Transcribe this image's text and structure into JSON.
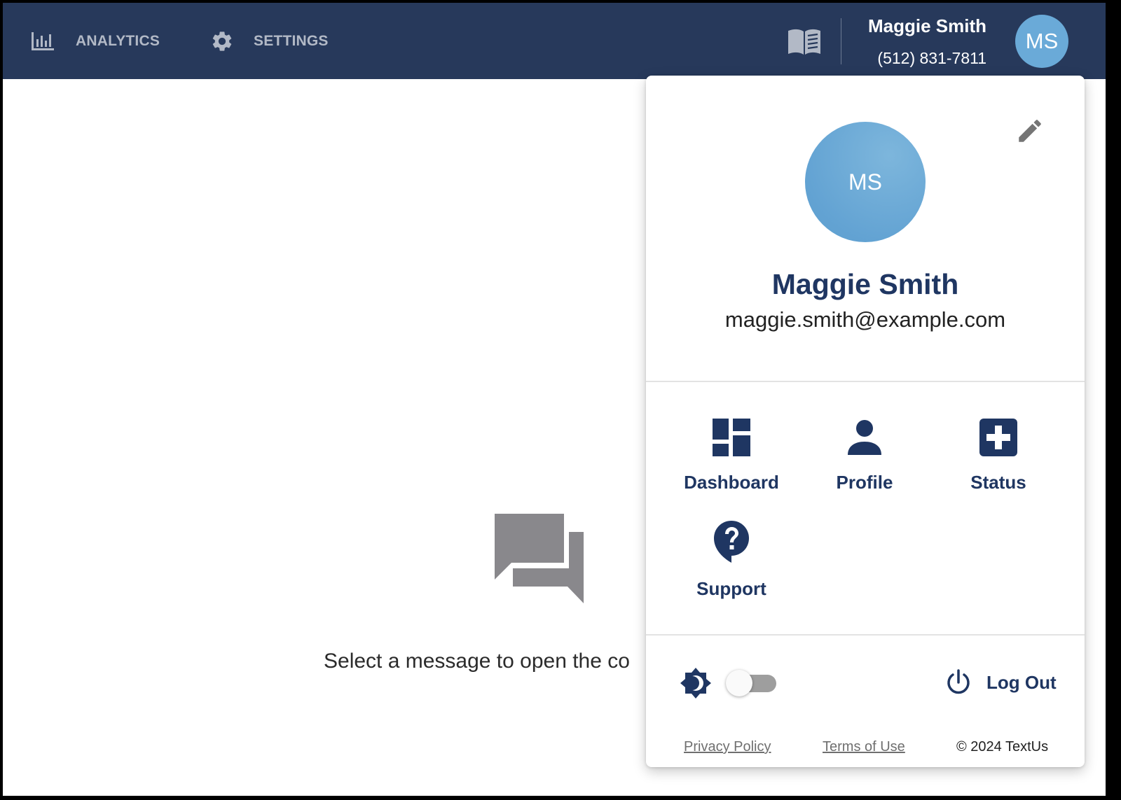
{
  "nav": {
    "analytics_label": "ANALYTICS",
    "settings_label": "SETTINGS",
    "analytics_icon": "bar-chart-icon",
    "settings_icon": "gear-icon",
    "knowledge_icon": "book-icon"
  },
  "account": {
    "name": "Maggie Smith",
    "phone": "(512) 831-7811",
    "initials": "MS"
  },
  "empty_state": {
    "icon": "chat-bubbles-icon",
    "message": "Select a message to open the co"
  },
  "popover": {
    "initials": "MS",
    "name": "Maggie Smith",
    "email": "maggie.smith@example.com",
    "edit_icon": "pencil-icon",
    "tiles": [
      {
        "label": "Dashboard",
        "icon": "dashboard-icon"
      },
      {
        "label": "Profile",
        "icon": "person-icon"
      },
      {
        "label": "Status",
        "icon": "plus-box-icon"
      },
      {
        "label": "Support",
        "icon": "help-bubble-icon"
      }
    ],
    "theme_toggle": {
      "icon": "brightness-icon",
      "on": false
    },
    "logout_label": "Log Out",
    "footer": {
      "privacy": "Privacy Policy",
      "terms": "Terms of Use",
      "copyright": "© 2024 TextUs"
    }
  },
  "colors": {
    "nav_bg": "#27395b",
    "accent_navy": "#1f3662",
    "avatar_blue": "#6aaad8",
    "nav_text": "#b2b9c6"
  }
}
